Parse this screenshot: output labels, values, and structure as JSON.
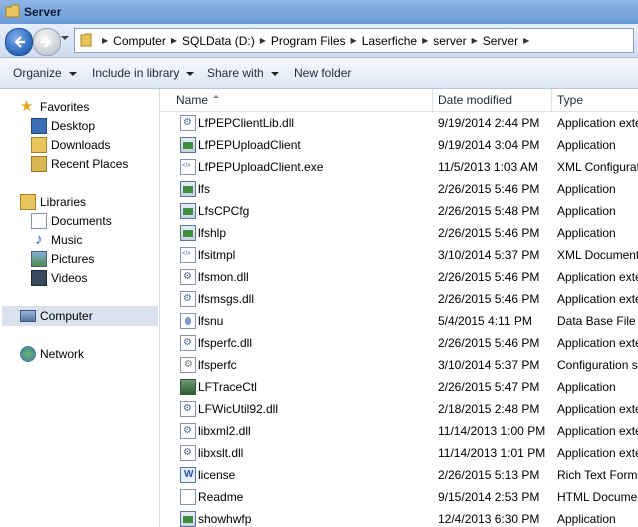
{
  "window": {
    "title": "Server"
  },
  "address": {
    "crumbs": [
      "Computer",
      "SQLData (D:)",
      "Program Files",
      "Laserfiche",
      "server",
      "Server"
    ]
  },
  "toolbar": {
    "organize": "Organize",
    "include_in_library": "Include in library",
    "share_with": "Share with",
    "new_folder": "New folder"
  },
  "nav": {
    "favorites": "Favorites",
    "desktop": "Desktop",
    "downloads": "Downloads",
    "recent_places": "Recent Places",
    "libraries": "Libraries",
    "documents": "Documents",
    "music": "Music",
    "pictures": "Pictures",
    "videos": "Videos",
    "computer": "Computer",
    "network": "Network"
  },
  "columns": {
    "name": "Name",
    "date": "Date modified",
    "type": "Type"
  },
  "files": [
    {
      "name": "LfPEPClientLib.dll",
      "date": "9/19/2014 2:44 PM",
      "type": "Application exten",
      "icon": "dll"
    },
    {
      "name": "LfPEPUploadClient",
      "date": "9/19/2014 3:04 PM",
      "type": "Application",
      "icon": "app"
    },
    {
      "name": "LfPEPUploadClient.exe",
      "date": "11/5/2013 1:03 AM",
      "type": "XML Configuratio",
      "icon": "xml"
    },
    {
      "name": "lfs",
      "date": "2/26/2015 5:46 PM",
      "type": "Application",
      "icon": "app"
    },
    {
      "name": "LfsCPCfg",
      "date": "2/26/2015 5:48 PM",
      "type": "Application",
      "icon": "app"
    },
    {
      "name": "lfshlp",
      "date": "2/26/2015 5:46 PM",
      "type": "Application",
      "icon": "app"
    },
    {
      "name": "lfsitmpl",
      "date": "3/10/2014 5:37 PM",
      "type": "XML Document",
      "icon": "xml"
    },
    {
      "name": "lfsmon.dll",
      "date": "2/26/2015 5:46 PM",
      "type": "Application exten",
      "icon": "dll"
    },
    {
      "name": "lfsmsgs.dll",
      "date": "2/26/2015 5:46 PM",
      "type": "Application exten",
      "icon": "dll"
    },
    {
      "name": "lfsnu",
      "date": "5/4/2015 4:11 PM",
      "type": "Data Base File",
      "icon": "db"
    },
    {
      "name": "lfsperfc.dll",
      "date": "2/26/2015 5:46 PM",
      "type": "Application exten",
      "icon": "dll"
    },
    {
      "name": "lfsperfc",
      "date": "3/10/2014 5:37 PM",
      "type": "Configuration se",
      "icon": "cfg"
    },
    {
      "name": "LFTraceCtl",
      "date": "2/26/2015 5:47 PM",
      "type": "Application",
      "icon": "trace"
    },
    {
      "name": "LFWicUtil92.dll",
      "date": "2/18/2015 2:48 PM",
      "type": "Application exten",
      "icon": "dll"
    },
    {
      "name": "libxml2.dll",
      "date": "11/14/2013 1:00 PM",
      "type": "Application exten",
      "icon": "dll"
    },
    {
      "name": "libxslt.dll",
      "date": "11/14/2013 1:01 PM",
      "type": "Application exten",
      "icon": "dll"
    },
    {
      "name": "license",
      "date": "2/26/2015 5:13 PM",
      "type": "Rich Text Format",
      "icon": "rtf"
    },
    {
      "name": "Readme",
      "date": "9/15/2014 2:53 PM",
      "type": "HTML Document",
      "icon": "html"
    },
    {
      "name": "showhwfp",
      "date": "12/4/2013 6:30 PM",
      "type": "Application",
      "icon": "app"
    }
  ]
}
